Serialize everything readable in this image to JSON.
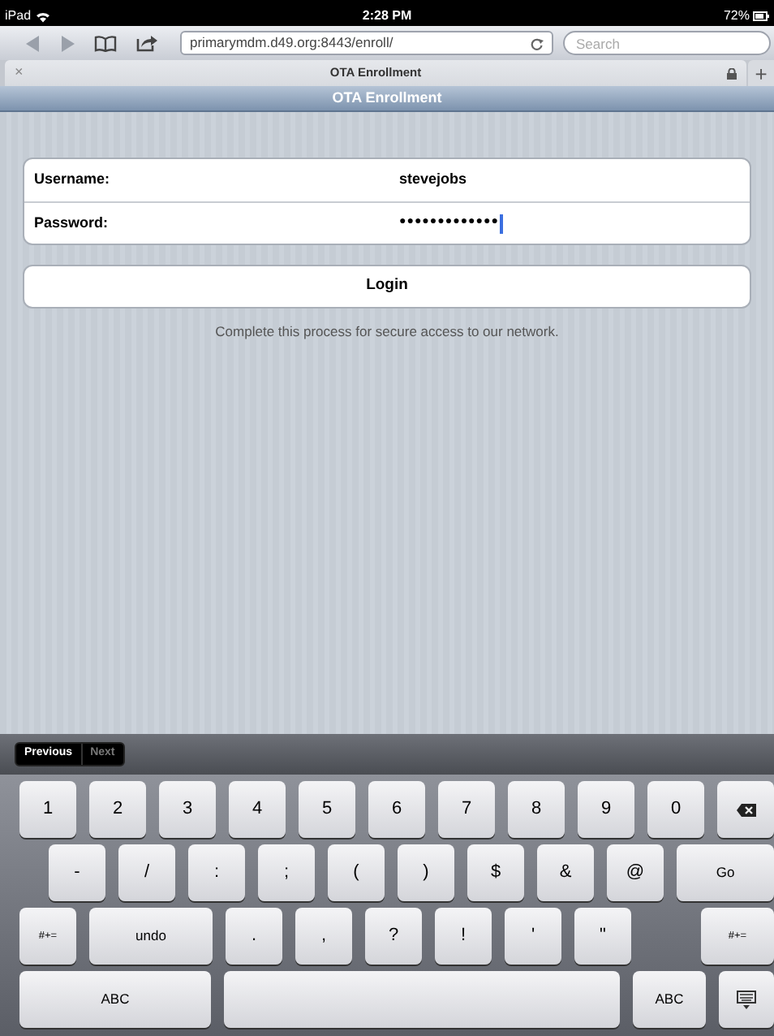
{
  "status_bar": {
    "device": "iPad",
    "time": "2:28 PM",
    "battery": "72%"
  },
  "toolbar": {
    "url": "primarymdm.d49.org:8443/enroll/",
    "search_placeholder": "Search"
  },
  "tab": {
    "close": "×",
    "title": "OTA Enrollment",
    "new_tab": "+"
  },
  "header": {
    "title": "OTA Enrollment"
  },
  "form": {
    "fields": [
      {
        "label": "Username:",
        "value": "stevejobs",
        "focused": false
      },
      {
        "label": "Password:",
        "value": "●●●●●●●●●●●●●",
        "focused": true
      }
    ],
    "button": "Login",
    "note": "Complete this process for secure access to our network."
  },
  "accessory": [
    {
      "label": "Previous",
      "disabled": false
    },
    {
      "label": "Next",
      "disabled": true
    }
  ],
  "keyboard": {
    "rows": [
      {
        "keys": [
          {
            "kind": "char",
            "label": "1"
          },
          {
            "kind": "char",
            "label": "2"
          },
          {
            "kind": "char",
            "label": "3"
          },
          {
            "kind": "char",
            "label": "4"
          },
          {
            "kind": "char",
            "label": "5"
          },
          {
            "kind": "char",
            "label": "6"
          },
          {
            "kind": "char",
            "label": "7"
          },
          {
            "kind": "char",
            "label": "8"
          },
          {
            "kind": "char",
            "label": "9"
          },
          {
            "kind": "char",
            "label": "0"
          },
          {
            "kind": "backspace"
          }
        ]
      },
      {
        "keys": [
          {
            "kind": "char",
            "label": "-"
          },
          {
            "kind": "char",
            "label": "/"
          },
          {
            "kind": "char",
            "label": ":"
          },
          {
            "kind": "char",
            "label": ";"
          },
          {
            "kind": "char",
            "label": "("
          },
          {
            "kind": "char",
            "label": ")"
          },
          {
            "kind": "char",
            "label": "$"
          },
          {
            "kind": "char",
            "label": "&"
          },
          {
            "kind": "char",
            "label": "@"
          },
          {
            "kind": "return",
            "label": "Go"
          }
        ]
      },
      {
        "keys": [
          {
            "kind": "symbols",
            "label": "#+="
          },
          {
            "kind": "undo",
            "label": "undo"
          },
          {
            "kind": "char",
            "label": "."
          },
          {
            "kind": "char",
            "label": ","
          },
          {
            "kind": "char",
            "label": "?"
          },
          {
            "kind": "char",
            "label": "!"
          },
          {
            "kind": "char",
            "label": "'"
          },
          {
            "kind": "char",
            "label": "\""
          },
          {
            "kind": "symbols",
            "label": "#+="
          }
        ]
      },
      {
        "keys": [
          {
            "kind": "mode",
            "label": "ABC"
          },
          {
            "kind": "space"
          },
          {
            "kind": "mode",
            "label": "ABC"
          },
          {
            "kind": "dismiss"
          }
        ]
      }
    ]
  }
}
